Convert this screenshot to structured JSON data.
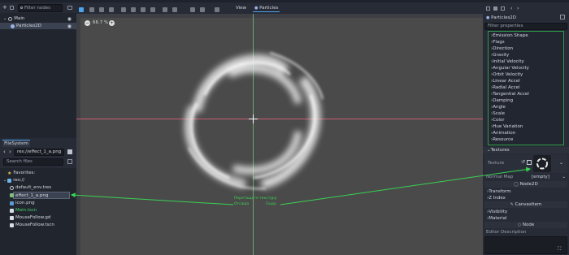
{
  "scene_dock": {
    "filter_placeholder": "Filter nodes",
    "tree": [
      {
        "label": "Main",
        "icon": "node2d-icon",
        "color": "#e0e0e0"
      },
      {
        "label": "Particles2D",
        "icon": "particles-icon",
        "color": "#e0e0e0"
      }
    ]
  },
  "filesystem": {
    "tab_label": "FileSystem",
    "path": "res://effect_1_a.png",
    "search_placeholder": "Search files",
    "favorites_label": "Favorites:",
    "root_label": "res://",
    "files": [
      {
        "name": "default_env.tres",
        "icon": "resource-icon"
      },
      {
        "name": "effect_1_a.png",
        "icon": "image-icon"
      },
      {
        "name": "icon.png",
        "icon": "image-icon"
      },
      {
        "name": "Main.tscn",
        "icon": "scene-icon"
      },
      {
        "name": "MouseFollow.gd",
        "icon": "script-icon"
      },
      {
        "name": "MouseFollow.tscn",
        "icon": "scene-icon"
      }
    ]
  },
  "viewport_toolbar": {
    "view_menu": "View",
    "particles_menu": "Particles"
  },
  "viewport": {
    "zoom_label": "66.7 %",
    "annotation_line1": "Перетащите текстуру",
    "annotation_from": "Отсюда",
    "annotation_to": "Сюда"
  },
  "inspector": {
    "node_title": "Particles2D",
    "filter_placeholder": "Filter properties",
    "sections": [
      "Emission Shape",
      "Flags",
      "Direction",
      "Gravity",
      "Initial Velocity",
      "Angular Velocity",
      "Orbit Velocity",
      "Linear Accel",
      "Radial Accel",
      "Tangential Accel",
      "Damping",
      "Angle",
      "Scale",
      "Color",
      "Hue Variation",
      "Animation",
      "Resource"
    ],
    "textures_label": "Textures",
    "texture_label": "Texture",
    "normal_map_label": "Normal Map",
    "normal_map_value": "[empty]",
    "node2d_header": "Node2D",
    "transform_label": "Transform",
    "zindex_label": "Z Index",
    "canvasitem_header": "CanvasItem",
    "visibility_label": "Visibility",
    "material_label": "Material",
    "node_header": "Node",
    "editor_description_label": "Editor Description"
  },
  "colors": {
    "accent": "#4fa3e8",
    "annotation": "#39d353",
    "viewport_bg": "#4a4a4a"
  }
}
